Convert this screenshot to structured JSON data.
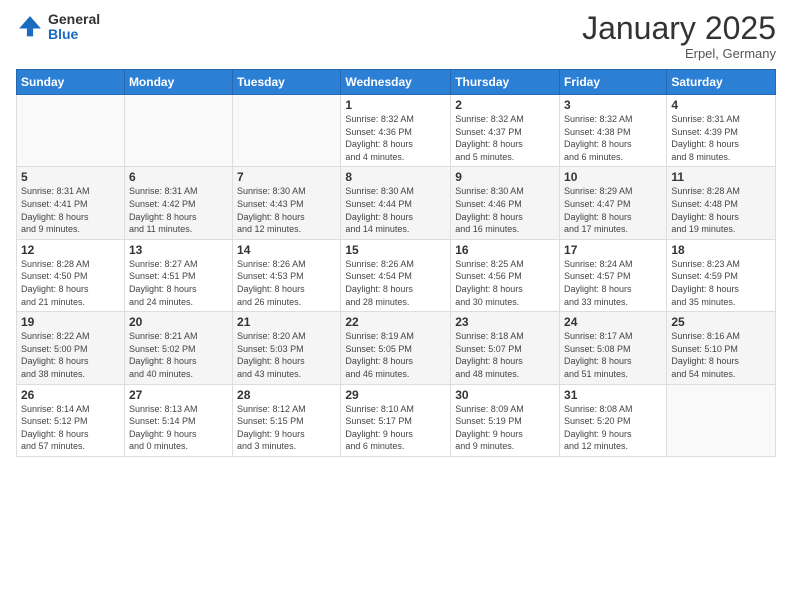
{
  "header": {
    "logo_general": "General",
    "logo_blue": "Blue",
    "month_title": "January 2025",
    "location": "Erpel, Germany"
  },
  "weekdays": [
    "Sunday",
    "Monday",
    "Tuesday",
    "Wednesday",
    "Thursday",
    "Friday",
    "Saturday"
  ],
  "weeks": [
    [
      {
        "day": "",
        "info": ""
      },
      {
        "day": "",
        "info": ""
      },
      {
        "day": "",
        "info": ""
      },
      {
        "day": "1",
        "info": "Sunrise: 8:32 AM\nSunset: 4:36 PM\nDaylight: 8 hours\nand 4 minutes."
      },
      {
        "day": "2",
        "info": "Sunrise: 8:32 AM\nSunset: 4:37 PM\nDaylight: 8 hours\nand 5 minutes."
      },
      {
        "day": "3",
        "info": "Sunrise: 8:32 AM\nSunset: 4:38 PM\nDaylight: 8 hours\nand 6 minutes."
      },
      {
        "day": "4",
        "info": "Sunrise: 8:31 AM\nSunset: 4:39 PM\nDaylight: 8 hours\nand 8 minutes."
      }
    ],
    [
      {
        "day": "5",
        "info": "Sunrise: 8:31 AM\nSunset: 4:41 PM\nDaylight: 8 hours\nand 9 minutes."
      },
      {
        "day": "6",
        "info": "Sunrise: 8:31 AM\nSunset: 4:42 PM\nDaylight: 8 hours\nand 11 minutes."
      },
      {
        "day": "7",
        "info": "Sunrise: 8:30 AM\nSunset: 4:43 PM\nDaylight: 8 hours\nand 12 minutes."
      },
      {
        "day": "8",
        "info": "Sunrise: 8:30 AM\nSunset: 4:44 PM\nDaylight: 8 hours\nand 14 minutes."
      },
      {
        "day": "9",
        "info": "Sunrise: 8:30 AM\nSunset: 4:46 PM\nDaylight: 8 hours\nand 16 minutes."
      },
      {
        "day": "10",
        "info": "Sunrise: 8:29 AM\nSunset: 4:47 PM\nDaylight: 8 hours\nand 17 minutes."
      },
      {
        "day": "11",
        "info": "Sunrise: 8:28 AM\nSunset: 4:48 PM\nDaylight: 8 hours\nand 19 minutes."
      }
    ],
    [
      {
        "day": "12",
        "info": "Sunrise: 8:28 AM\nSunset: 4:50 PM\nDaylight: 8 hours\nand 21 minutes."
      },
      {
        "day": "13",
        "info": "Sunrise: 8:27 AM\nSunset: 4:51 PM\nDaylight: 8 hours\nand 24 minutes."
      },
      {
        "day": "14",
        "info": "Sunrise: 8:26 AM\nSunset: 4:53 PM\nDaylight: 8 hours\nand 26 minutes."
      },
      {
        "day": "15",
        "info": "Sunrise: 8:26 AM\nSunset: 4:54 PM\nDaylight: 8 hours\nand 28 minutes."
      },
      {
        "day": "16",
        "info": "Sunrise: 8:25 AM\nSunset: 4:56 PM\nDaylight: 8 hours\nand 30 minutes."
      },
      {
        "day": "17",
        "info": "Sunrise: 8:24 AM\nSunset: 4:57 PM\nDaylight: 8 hours\nand 33 minutes."
      },
      {
        "day": "18",
        "info": "Sunrise: 8:23 AM\nSunset: 4:59 PM\nDaylight: 8 hours\nand 35 minutes."
      }
    ],
    [
      {
        "day": "19",
        "info": "Sunrise: 8:22 AM\nSunset: 5:00 PM\nDaylight: 8 hours\nand 38 minutes."
      },
      {
        "day": "20",
        "info": "Sunrise: 8:21 AM\nSunset: 5:02 PM\nDaylight: 8 hours\nand 40 minutes."
      },
      {
        "day": "21",
        "info": "Sunrise: 8:20 AM\nSunset: 5:03 PM\nDaylight: 8 hours\nand 43 minutes."
      },
      {
        "day": "22",
        "info": "Sunrise: 8:19 AM\nSunset: 5:05 PM\nDaylight: 8 hours\nand 46 minutes."
      },
      {
        "day": "23",
        "info": "Sunrise: 8:18 AM\nSunset: 5:07 PM\nDaylight: 8 hours\nand 48 minutes."
      },
      {
        "day": "24",
        "info": "Sunrise: 8:17 AM\nSunset: 5:08 PM\nDaylight: 8 hours\nand 51 minutes."
      },
      {
        "day": "25",
        "info": "Sunrise: 8:16 AM\nSunset: 5:10 PM\nDaylight: 8 hours\nand 54 minutes."
      }
    ],
    [
      {
        "day": "26",
        "info": "Sunrise: 8:14 AM\nSunset: 5:12 PM\nDaylight: 8 hours\nand 57 minutes."
      },
      {
        "day": "27",
        "info": "Sunrise: 8:13 AM\nSunset: 5:14 PM\nDaylight: 9 hours\nand 0 minutes."
      },
      {
        "day": "28",
        "info": "Sunrise: 8:12 AM\nSunset: 5:15 PM\nDaylight: 9 hours\nand 3 minutes."
      },
      {
        "day": "29",
        "info": "Sunrise: 8:10 AM\nSunset: 5:17 PM\nDaylight: 9 hours\nand 6 minutes."
      },
      {
        "day": "30",
        "info": "Sunrise: 8:09 AM\nSunset: 5:19 PM\nDaylight: 9 hours\nand 9 minutes."
      },
      {
        "day": "31",
        "info": "Sunrise: 8:08 AM\nSunset: 5:20 PM\nDaylight: 9 hours\nand 12 minutes."
      },
      {
        "day": "",
        "info": ""
      }
    ]
  ]
}
